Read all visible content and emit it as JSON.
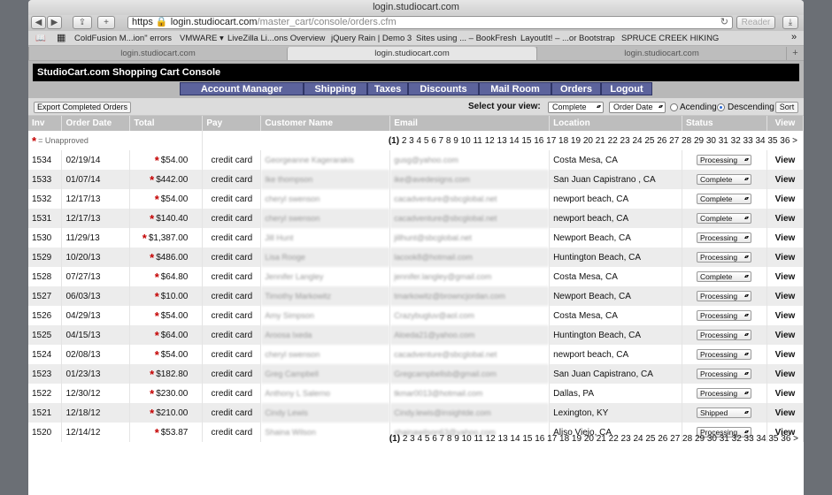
{
  "browser": {
    "title": "login.studiocart.com",
    "url_scheme": "https",
    "url_host": "login.studiocart.com",
    "url_path": "/master_cart/console/orders.cfm",
    "reader_label": "Reader",
    "bookmarks": [
      "ColdFusion M...ion\" errors",
      "VMWARE ▾",
      "LiveZilla Li...ons Overview",
      "jQuery Rain | Demo 3",
      "Sites using ... – BookFresh",
      "LayoutIt! – ...or Bootstrap",
      "SPRUCE CREEK HIKING"
    ],
    "tabs": [
      "login.studiocart.com",
      "login.studiocart.com",
      "login.studiocart.com"
    ]
  },
  "app": {
    "title": "StudioCart.com Shopping Cart Console",
    "nav": [
      "Account Manager",
      "Shipping",
      "Taxes",
      "Discounts",
      "Mail Room",
      "Orders",
      "Logout"
    ]
  },
  "actions": {
    "export_label": "Export Completed Orders",
    "view_label": "Select your view:",
    "view_value": "Complete",
    "sort_value": "Order Date",
    "asc_label": "Acending",
    "desc_label": "Descending",
    "sort_button": "Sort"
  },
  "table": {
    "headers": [
      "Inv",
      "Order Date",
      "Total",
      "Pay",
      "Customer Name",
      "Email",
      "Location",
      "Status",
      "View"
    ],
    "legend_star": "*",
    "legend_text": "= Unapproved",
    "pager_current": "(1)",
    "pager_rest": "2 3 4 5 6 7 8 9 10 11 12 13 14 15 16 17 18 19 20 21 22 23 24 25 26 27 28 29 30 31 32 33 34 35 36 >",
    "view_label": "View",
    "rows": [
      {
        "inv": "1534",
        "date": "02/19/14",
        "total": "$54.00",
        "pay": "credit card",
        "name": "Georgeanne Kagerarakis",
        "email": "gusg@yahoo.com",
        "location": "Costa Mesa, CA",
        "status": "Processing"
      },
      {
        "inv": "1533",
        "date": "01/07/14",
        "total": "$442.00",
        "pay": "credit card",
        "name": "Ike thompson",
        "email": "ike@avedesigns.com",
        "location": "San Juan Capistrano , CA",
        "status": "Complete"
      },
      {
        "inv": "1532",
        "date": "12/17/13",
        "total": "$54.00",
        "pay": "credit card",
        "name": "cheryl swenson",
        "email": "cacadventure@sbcglobal.net",
        "location": "newport beach, CA",
        "status": "Complete"
      },
      {
        "inv": "1531",
        "date": "12/17/13",
        "total": "$140.40",
        "pay": "credit card",
        "name": "cheryl swenson",
        "email": "cacadventure@sbcglobal.net",
        "location": "newport beach, CA",
        "status": "Complete"
      },
      {
        "inv": "1530",
        "date": "11/29/13",
        "total": "$1,387.00",
        "pay": "credit card",
        "name": "Jill Hunt",
        "email": "jillhunt@sbcglobal.net",
        "location": "Newport Beach, CA",
        "status": "Processing"
      },
      {
        "inv": "1529",
        "date": "10/20/13",
        "total": "$486.00",
        "pay": "credit card",
        "name": "Lisa Rooge",
        "email": "lacook8@hotmail.com",
        "location": "Huntington Beach, CA",
        "status": "Processing"
      },
      {
        "inv": "1528",
        "date": "07/27/13",
        "total": "$64.80",
        "pay": "credit card",
        "name": "Jennifer Langley",
        "email": "jennifer.langley@gmail.com",
        "location": "Costa Mesa, CA",
        "status": "Complete"
      },
      {
        "inv": "1527",
        "date": "06/03/13",
        "total": "$10.00",
        "pay": "credit card",
        "name": "Timothy Markowitz",
        "email": "tmarkowitz@browncjordan.com",
        "location": "Newport Beach, CA",
        "status": "Processing"
      },
      {
        "inv": "1526",
        "date": "04/29/13",
        "total": "$54.00",
        "pay": "credit card",
        "name": "Amy Simpson",
        "email": "Crazybugluv@aol.com",
        "location": "Costa Mesa, CA",
        "status": "Processing"
      },
      {
        "inv": "1525",
        "date": "04/15/13",
        "total": "$64.00",
        "pay": "credit card",
        "name": "Aroosa Ixeda",
        "email": "Aloeda21@yahoo.com",
        "location": "Huntington Beach, CA",
        "status": "Processing"
      },
      {
        "inv": "1524",
        "date": "02/08/13",
        "total": "$54.00",
        "pay": "credit card",
        "name": "cheryl swenson",
        "email": "cacadventure@sbcglobal.net",
        "location": "newport beach, CA",
        "status": "Processing"
      },
      {
        "inv": "1523",
        "date": "01/23/13",
        "total": "$182.80",
        "pay": "credit card",
        "name": "Greg Campbell",
        "email": "Gregcampbellsb@gmail.com",
        "location": "San Juan Capistrano, CA",
        "status": "Processing"
      },
      {
        "inv": "1522",
        "date": "12/30/12",
        "total": "$230.00",
        "pay": "credit card",
        "name": "Anthony L Salerno",
        "email": "tkmar0013@hotmail.com",
        "location": "Dallas, PA",
        "status": "Processing"
      },
      {
        "inv": "1521",
        "date": "12/18/12",
        "total": "$210.00",
        "pay": "credit card",
        "name": "Cindy Lewis",
        "email": "Cindy.lewis@insightde.com",
        "location": "Lexington, KY",
        "status": "Shipped"
      },
      {
        "inv": "1520",
        "date": "12/14/12",
        "total": "$53.87",
        "pay": "credit card",
        "name": "Shaina Wilson",
        "email": "shainawilson63@yahoo.com",
        "location": "Aliso Viejo, CA",
        "status": "Processing"
      }
    ]
  }
}
